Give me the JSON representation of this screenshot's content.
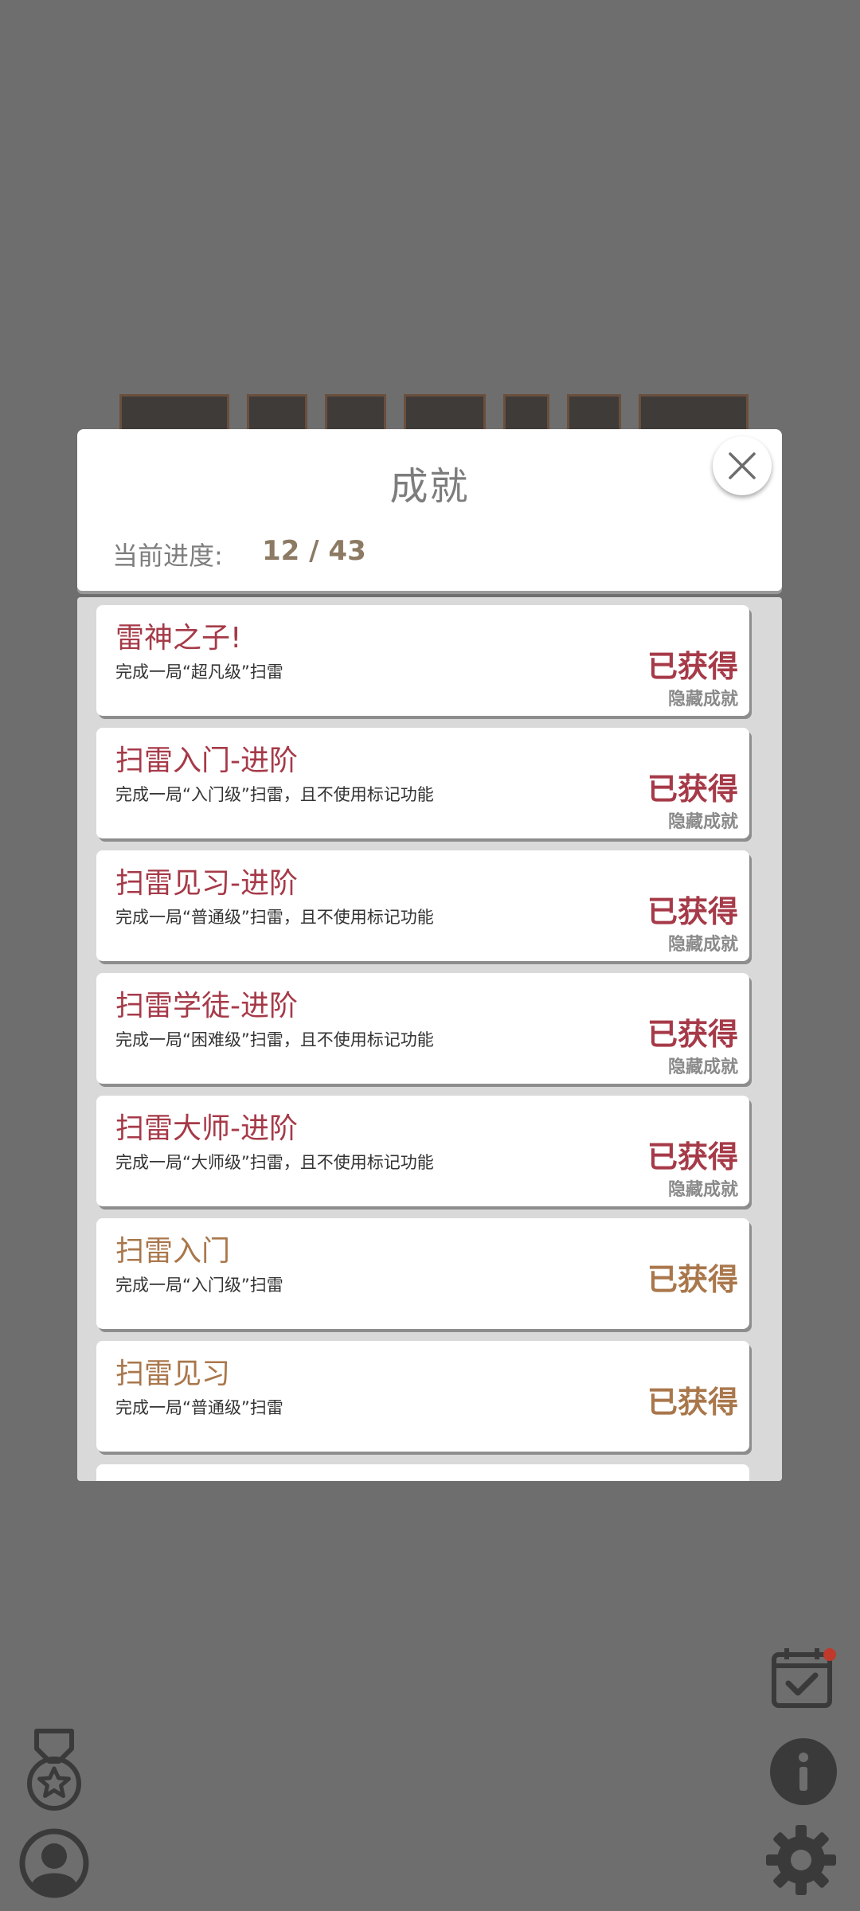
{
  "dialog": {
    "title": "成就",
    "progress_label": "当前进度:",
    "progress_value": "12 / 43"
  },
  "achievements": [
    {
      "name": "雷神之子!",
      "desc": "完成一局“超凡级”扫雷",
      "status": "已获得",
      "tag": "隐藏成就",
      "hidden": true
    },
    {
      "name": "扫雷入门-进阶",
      "desc": "完成一局“入门级”扫雷，且不使用标记功能",
      "status": "已获得",
      "tag": "隐藏成就",
      "hidden": true
    },
    {
      "name": "扫雷见习-进阶",
      "desc": "完成一局“普通级”扫雷，且不使用标记功能",
      "status": "已获得",
      "tag": "隐藏成就",
      "hidden": true
    },
    {
      "name": "扫雷学徒-进阶",
      "desc": "完成一局“困难级”扫雷，且不使用标记功能",
      "status": "已获得",
      "tag": "隐藏成就",
      "hidden": true
    },
    {
      "name": "扫雷大师-进阶",
      "desc": "完成一局“大师级”扫雷，且不使用标记功能",
      "status": "已获得",
      "tag": "隐藏成就",
      "hidden": true
    },
    {
      "name": "扫雷入门",
      "desc": "完成一局“入门级”扫雷",
      "status": "已获得",
      "tag": "",
      "hidden": false
    },
    {
      "name": "扫雷见习",
      "desc": "完成一局“普通级”扫雷",
      "status": "已获得",
      "tag": "",
      "hidden": false
    }
  ],
  "colors": {
    "hidden_accent": "#a63a48",
    "normal_accent": "#a9774b",
    "overlay_background": "#6e6e6e",
    "notification_dot": "#c0392b"
  },
  "icons": {
    "close": "close-icon",
    "medal": "medal-icon",
    "profile": "profile-icon",
    "calendar": "calendar-check-icon",
    "info": "info-icon",
    "settings": "gear-icon"
  }
}
